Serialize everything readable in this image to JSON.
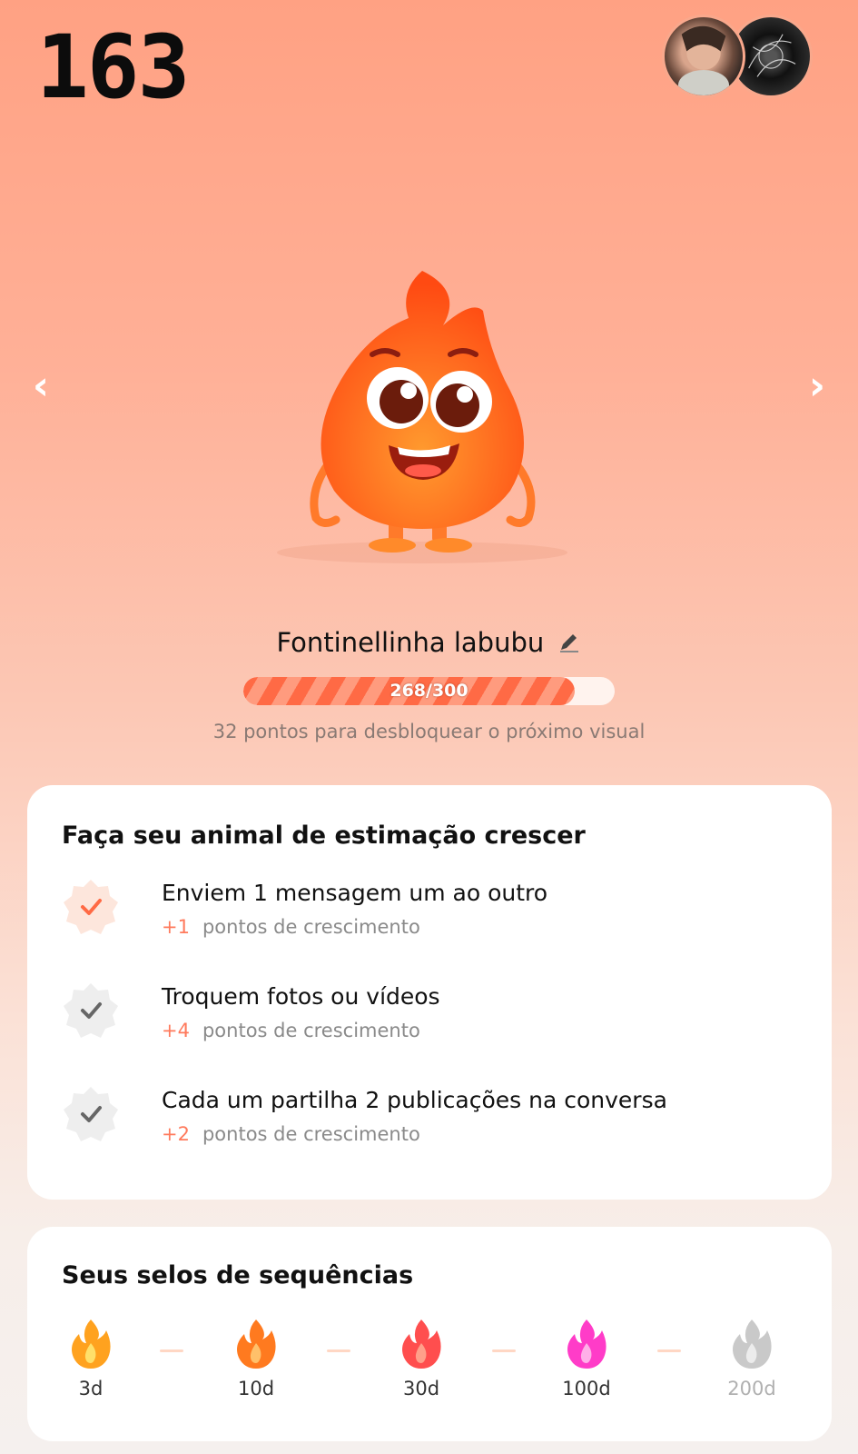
{
  "header": {
    "streak_count": "163",
    "avatars": [
      "avatar-user",
      "avatar-friend"
    ]
  },
  "pet": {
    "name": "Fontinellinha labubu",
    "progress_label": "268/300",
    "progress_value": 268,
    "progress_max": 300,
    "progress_hint": "32 pontos para desbloquear o próximo visual"
  },
  "tasks_card": {
    "title": "Faça seu animal de estimação crescer",
    "tasks": [
      {
        "title": "Enviem 1 mensagem um ao outro",
        "points": "+1",
        "points_label": "pontos de crescimento",
        "done": true
      },
      {
        "title": "Troquem fotos ou vídeos",
        "points": "+4",
        "points_label": "pontos de crescimento",
        "done": false
      },
      {
        "title": "Cada um partilha 2 publicações na conversa",
        "points": "+2",
        "points_label": "pontos de crescimento",
        "done": false
      }
    ]
  },
  "badges_card": {
    "title": "Seus selos de sequências",
    "badges": [
      {
        "label": "3d",
        "color": "#ffa21f",
        "unlocked": true
      },
      {
        "label": "10d",
        "color": "#ff7a1f",
        "unlocked": true
      },
      {
        "label": "30d",
        "color": "#ff4e4e",
        "unlocked": true
      },
      {
        "label": "100d",
        "color": "#ff3cc8",
        "unlocked": true
      },
      {
        "label": "200d",
        "color": "#c9c9c9",
        "unlocked": false
      }
    ]
  },
  "colors": {
    "accent": "#ff6a45",
    "check_done": "#ff7a5c",
    "check_pending": "#6b6b6b"
  }
}
